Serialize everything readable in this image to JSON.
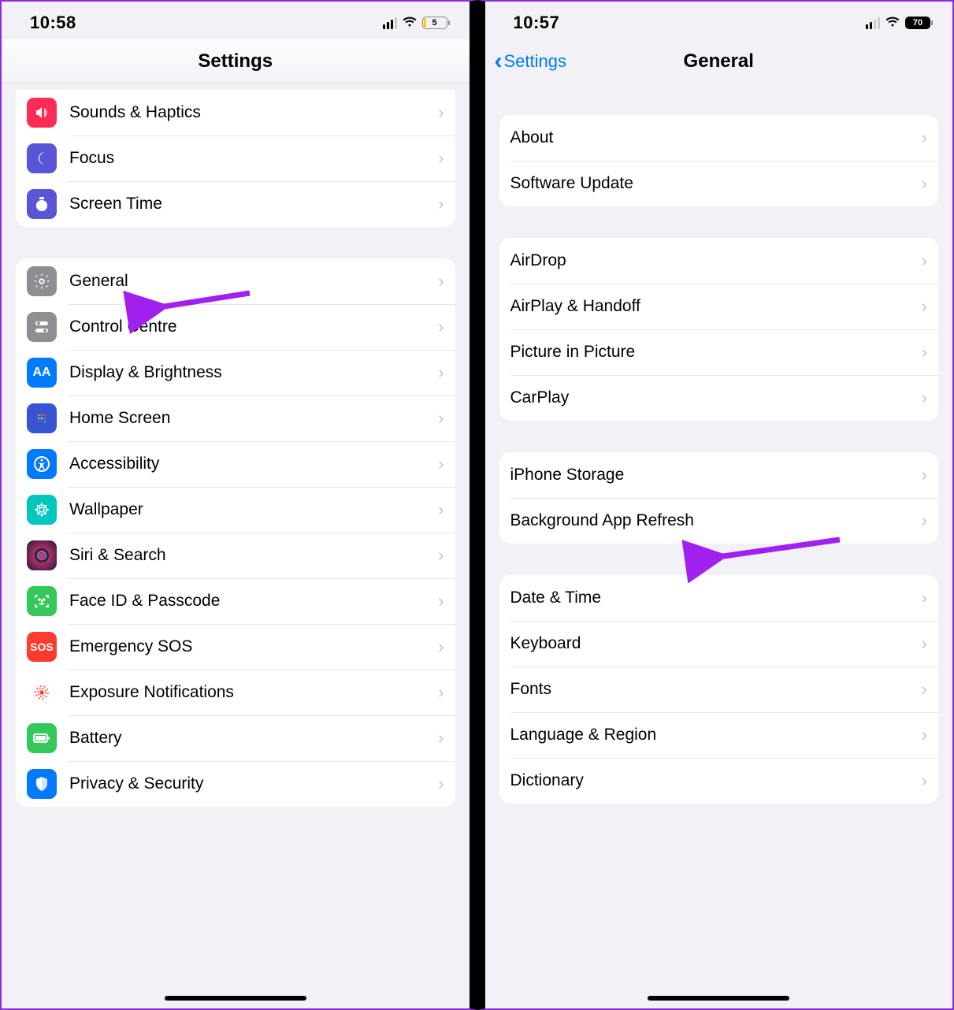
{
  "left": {
    "status": {
      "time": "10:58",
      "battery": "5"
    },
    "title": "Settings",
    "group1": [
      {
        "icon": "sounds-icon",
        "label": "Sounds & Haptics"
      },
      {
        "icon": "focus-icon",
        "label": "Focus"
      },
      {
        "icon": "screen-time-icon",
        "label": "Screen Time"
      }
    ],
    "group2": [
      {
        "icon": "general-icon",
        "label": "General"
      },
      {
        "icon": "control-centre-icon",
        "label": "Control Centre"
      },
      {
        "icon": "display-icon",
        "label": "Display & Brightness"
      },
      {
        "icon": "home-screen-icon",
        "label": "Home Screen"
      },
      {
        "icon": "accessibility-icon",
        "label": "Accessibility"
      },
      {
        "icon": "wallpaper-icon",
        "label": "Wallpaper"
      },
      {
        "icon": "siri-icon",
        "label": "Siri & Search"
      },
      {
        "icon": "faceid-icon",
        "label": "Face ID & Passcode"
      },
      {
        "icon": "sos-icon",
        "label": "Emergency SOS"
      },
      {
        "icon": "exposure-icon",
        "label": "Exposure Notifications"
      },
      {
        "icon": "battery-icon",
        "label": "Battery"
      },
      {
        "icon": "privacy-icon",
        "label": "Privacy & Security"
      }
    ]
  },
  "right": {
    "status": {
      "time": "10:57",
      "battery": "70"
    },
    "back": "Settings",
    "title": "General",
    "g1": [
      {
        "label": "About"
      },
      {
        "label": "Software Update"
      }
    ],
    "g2": [
      {
        "label": "AirDrop"
      },
      {
        "label": "AirPlay & Handoff"
      },
      {
        "label": "Picture in Picture"
      },
      {
        "label": "CarPlay"
      }
    ],
    "g3": [
      {
        "label": "iPhone Storage"
      },
      {
        "label": "Background App Refresh"
      }
    ],
    "g4": [
      {
        "label": "Date & Time"
      },
      {
        "label": "Keyboard"
      },
      {
        "label": "Fonts"
      },
      {
        "label": "Language & Region"
      },
      {
        "label": "Dictionary"
      }
    ]
  },
  "annotation_color": "#a020f0"
}
